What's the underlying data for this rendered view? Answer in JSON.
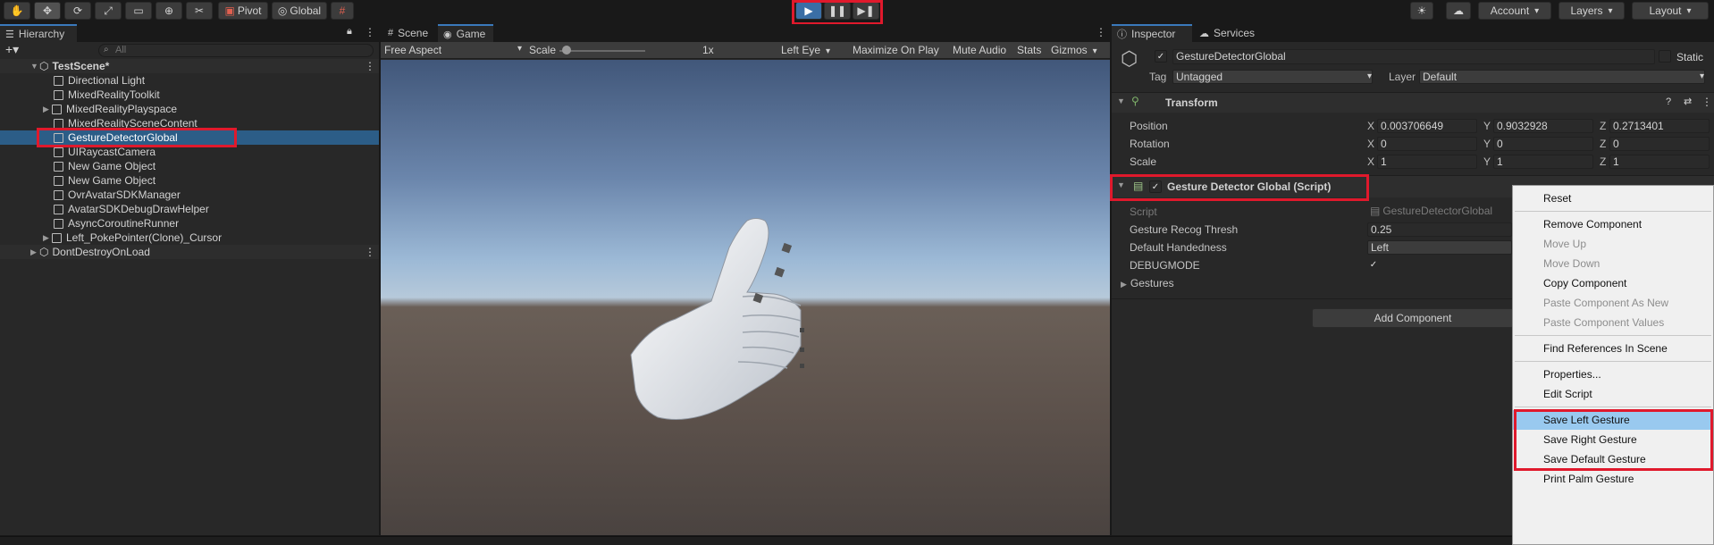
{
  "toolbar": {
    "pivot": "Pivot",
    "global": "Global",
    "account": "Account",
    "layers": "Layers",
    "layout": "Layout"
  },
  "hierarchy": {
    "tab": "Hierarchy",
    "search_placeholder": "All",
    "scene": "TestScene*",
    "items": [
      {
        "label": "Directional Light"
      },
      {
        "label": "MixedRealityToolkit"
      },
      {
        "label": "MixedRealityPlayspace"
      },
      {
        "label": "MixedRealitySceneContent"
      },
      {
        "label": "GestureDetectorGlobal"
      },
      {
        "label": "UIRaycastCamera"
      },
      {
        "label": "New Game Object"
      },
      {
        "label": "New Game Object"
      },
      {
        "label": "OvrAvatarSDKManager"
      },
      {
        "label": "AvatarSDKDebugDrawHelper"
      },
      {
        "label": "AsyncCoroutineRunner"
      },
      {
        "label": "Left_PokePointer(Clone)_Cursor"
      }
    ],
    "dontdestroy": "DontDestroyOnLoad"
  },
  "game": {
    "tab_scene": "Scene",
    "tab_game": "Game",
    "aspect": "Free Aspect",
    "scale_label": "Scale",
    "scale_value": "1x",
    "eye": "Left Eye",
    "maximize": "Maximize On Play",
    "mute": "Mute Audio",
    "stats": "Stats",
    "gizmos": "Gizmos"
  },
  "inspector": {
    "tab": "Inspector",
    "tab_services": "Services",
    "object_name": "GestureDetectorGlobal",
    "static": "Static",
    "tag_label": "Tag",
    "tag_value": "Untagged",
    "layer_label": "Layer",
    "layer_value": "Default",
    "transform": {
      "title": "Transform",
      "position_label": "Position",
      "rotation_label": "Rotation",
      "scale_label": "Scale",
      "position": {
        "x": "0.003706649",
        "y": "0.9032928",
        "z": "0.2713401"
      },
      "rotation": {
        "x": "0",
        "y": "0",
        "z": "0"
      },
      "scale": {
        "x": "1",
        "y": "1",
        "z": "1"
      }
    },
    "script_component": {
      "title": "Gesture Detector Global (Script)",
      "script_label": "Script",
      "script_value": "GestureDetectorGlobal",
      "thresh_label": "Gesture Recog Thresh",
      "thresh_value": "0.25",
      "hand_label": "Default Handedness",
      "hand_value": "Left",
      "debug_label": "DEBUGMODE",
      "gestures_label": "Gestures"
    },
    "add_component": "Add Component"
  },
  "context_menu": {
    "items": [
      {
        "label": "Reset"
      },
      {
        "label": "Remove Component"
      },
      {
        "label": "Move Up"
      },
      {
        "label": "Move Down"
      },
      {
        "label": "Copy Component"
      },
      {
        "label": "Paste Component As New"
      },
      {
        "label": "Paste Component Values"
      },
      {
        "label": "Find References In Scene"
      },
      {
        "label": "Properties..."
      },
      {
        "label": "Edit Script"
      },
      {
        "label": "Save Left Gesture"
      },
      {
        "label": "Save Right Gesture"
      },
      {
        "label": "Save Default Gesture"
      },
      {
        "label": "Print Palm Gesture"
      }
    ]
  },
  "colors": {
    "highlight_red": "#e0192c",
    "selection_blue": "#2c5d87",
    "accent_blue": "#3a79bb"
  }
}
